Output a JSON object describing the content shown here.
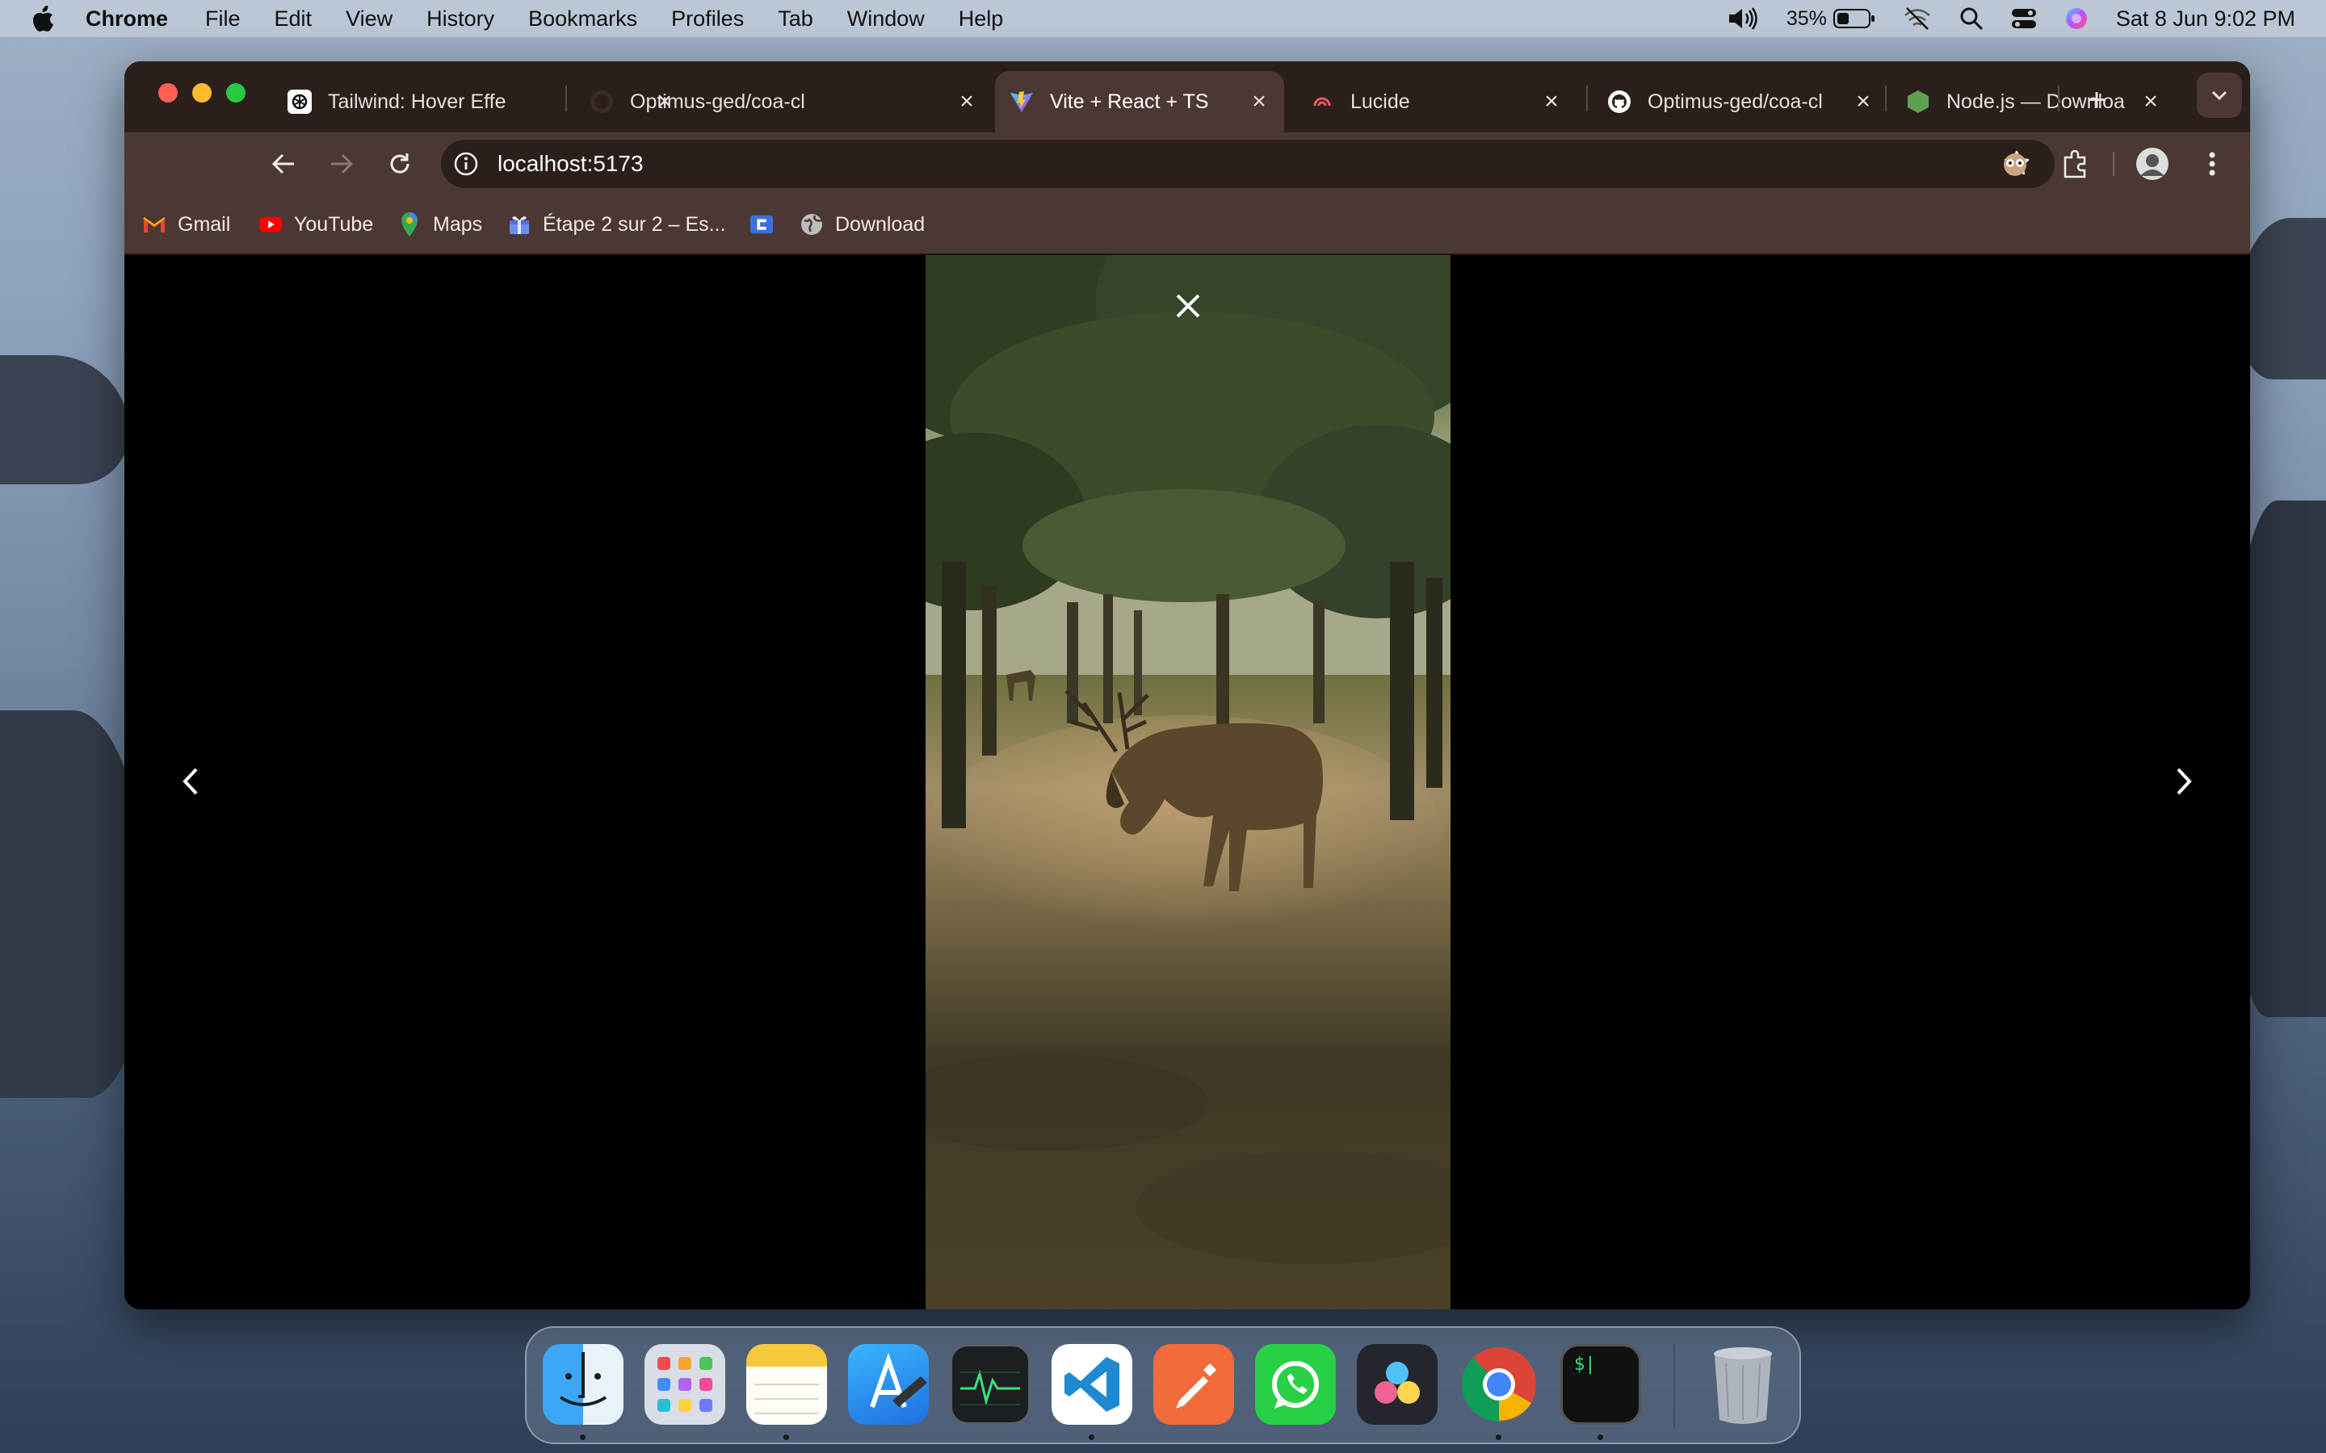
{
  "menubar": {
    "app_name": "Chrome",
    "menus": [
      "File",
      "Edit",
      "View",
      "History",
      "Bookmarks",
      "Profiles",
      "Tab",
      "Window",
      "Help"
    ],
    "battery_percent": "35%",
    "datetime": "Sat 8 Jun  9:02 PM"
  },
  "browser": {
    "tabs": [
      {
        "title": "Tailwind: Hover Effe",
        "icon": "openai-icon",
        "active": false
      },
      {
        "title": "Optimus-ged/coa-cl",
        "icon": "github-icon",
        "active": false
      },
      {
        "title": "Vite + React + TS",
        "icon": "vite-icon",
        "active": true
      },
      {
        "title": "Lucide",
        "icon": "lucide-icon",
        "active": false
      },
      {
        "title": "Optimus-ged/coa-cl",
        "icon": "github-icon",
        "active": false
      },
      {
        "title": "Node.js — Downloa",
        "icon": "nodejs-icon",
        "active": false
      }
    ],
    "address": "localhost:5173",
    "bookmarks": [
      {
        "label": "Gmail",
        "icon": "gmail-icon"
      },
      {
        "label": "YouTube",
        "icon": "youtube-icon"
      },
      {
        "label": "Maps",
        "icon": "maps-icon"
      },
      {
        "label": "Étape 2 sur 2 – Es...",
        "icon": "gift-icon"
      },
      {
        "label": "",
        "icon": "canva-icon"
      },
      {
        "label": "Download",
        "icon": "globe-icon"
      }
    ]
  },
  "lightbox": {
    "image_subject": "deer-grazing-photo",
    "close_icon": "close-icon",
    "prev_icon": "chevron-left-icon",
    "next_icon": "chevron-right-icon"
  },
  "dock": {
    "apps": [
      "finder",
      "launchpad",
      "notes",
      "xcode-simulator",
      "activity-monitor",
      "vscode",
      "postman",
      "whatsapp",
      "davinci-resolve",
      "chrome",
      "terminal",
      "trash"
    ],
    "terminal_prompt": "$|"
  },
  "colors": {
    "tabbar": "#2b1f1c",
    "toolbar": "#4c3833",
    "content": "#000000"
  }
}
